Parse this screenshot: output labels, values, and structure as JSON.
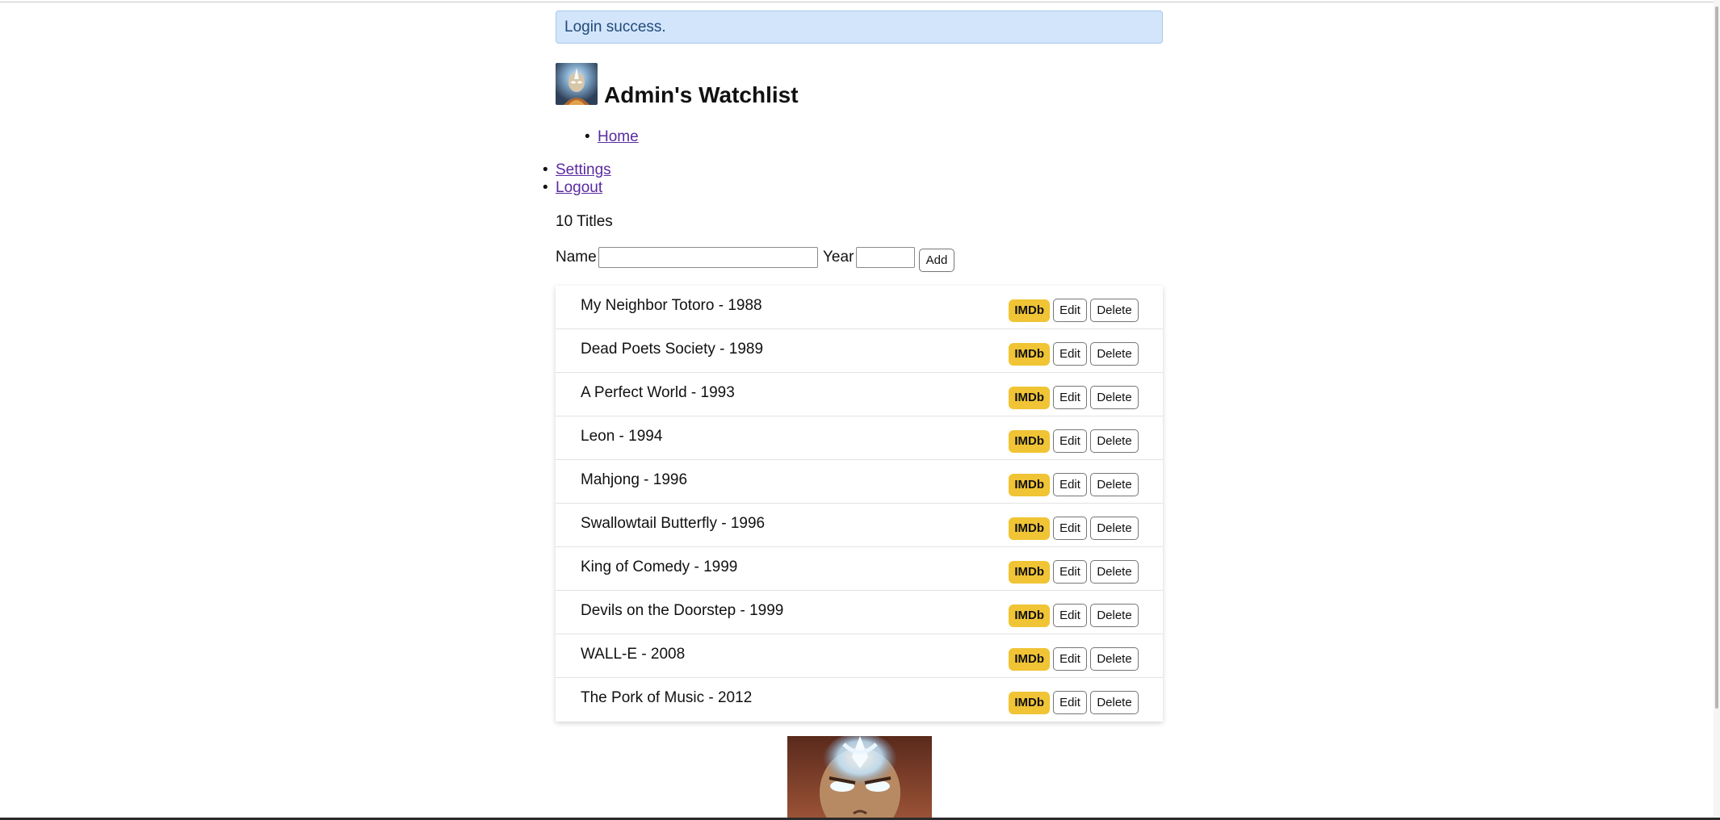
{
  "flash": {
    "message": "Login success."
  },
  "header": {
    "title": "Admin's Watchlist",
    "avatar_icon": "avatar-icon"
  },
  "nav": {
    "home": "Home",
    "settings": "Settings",
    "logout": "Logout",
    "bullet": "•"
  },
  "summary": {
    "count_text": "10 Titles"
  },
  "add_form": {
    "name_label": "Name",
    "name_value": "",
    "year_label": "Year",
    "year_value": "",
    "add_label": "Add"
  },
  "movies": [
    {
      "title": "My Neighbor Totoro - 1988",
      "imdb": "IMDb",
      "edit": "Edit",
      "delete": "Delete"
    },
    {
      "title": "Dead Poets Society - 1989",
      "imdb": "IMDb",
      "edit": "Edit",
      "delete": "Delete"
    },
    {
      "title": "A Perfect World - 1993",
      "imdb": "IMDb",
      "edit": "Edit",
      "delete": "Delete"
    },
    {
      "title": "Leon - 1994",
      "imdb": "IMDb",
      "edit": "Edit",
      "delete": "Delete"
    },
    {
      "title": "Mahjong - 1996",
      "imdb": "IMDb",
      "edit": "Edit",
      "delete": "Delete"
    },
    {
      "title": "Swallowtail Butterfly - 1996",
      "imdb": "IMDb",
      "edit": "Edit",
      "delete": "Delete"
    },
    {
      "title": "King of Comedy - 1999",
      "imdb": "IMDb",
      "edit": "Edit",
      "delete": "Delete"
    },
    {
      "title": "Devils on the Doorstep - 1999",
      "imdb": "IMDb",
      "edit": "Edit",
      "delete": "Delete"
    },
    {
      "title": "WALL-E - 2008",
      "imdb": "IMDb",
      "edit": "Edit",
      "delete": "Delete"
    },
    {
      "title": "The Pork of Music - 2012",
      "imdb": "IMDb",
      "edit": "Edit",
      "delete": "Delete"
    }
  ],
  "colors": {
    "alert_bg": "#d2e5fb",
    "alert_text": "#224a7a",
    "link": "#5a2aa0",
    "imdb_badge": "#f0c434"
  },
  "footer": {
    "image_icon": "avatar-character-icon"
  }
}
